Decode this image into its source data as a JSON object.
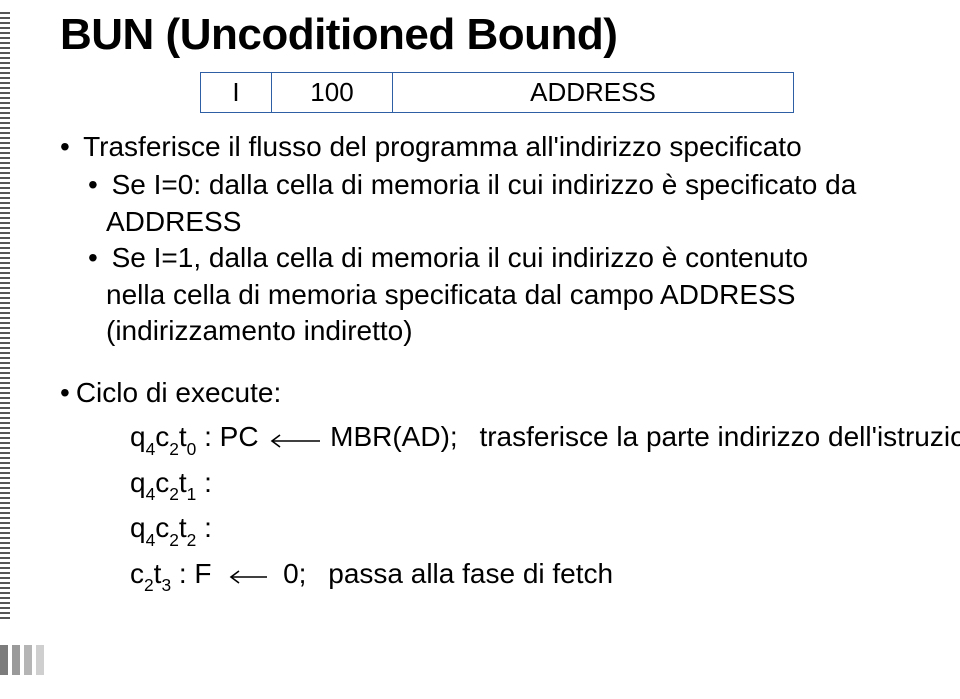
{
  "title": "BUN (Uncoditioned Bound)",
  "instruction": {
    "i": "I",
    "opcode": "100",
    "address": "ADDRESS"
  },
  "bullet_main": "Trasferisce il flusso del programma all'indirizzo specificato",
  "bullet_sub1_a": "Se I=0: dalla cella di memoria il cui indirizzo è specificato da",
  "bullet_sub1_b": "ADDRESS",
  "bullet_sub2_a": "Se I=1, dalla cella di memoria il cui indirizzo è contenuto",
  "bullet_sub2_b": "nella cella di memoria specificata dal campo ADDRESS",
  "bullet_sub2_c": "(indirizzamento indiretto)",
  "cycle_title": "Ciclo di execute:",
  "cycle": {
    "l1_prefix": "q",
    "l1_s1": "4",
    "l1_c": "c",
    "l1_s2": "2",
    "l1_t": "t",
    "l1_s3": "0",
    "l1_colon": " : PC",
    "l1_rhs": "MBR(AD);",
    "l1_comment": "trasferisce la parte indirizzo dell'istruzione",
    "l2_prefix": "q",
    "l2_s1": "4",
    "l2_c": "c",
    "l2_s2": "2",
    "l2_t": "t",
    "l2_s3": "1",
    "l2_colon": " :",
    "l3_prefix": "q",
    "l3_s1": "4",
    "l3_c": "c",
    "l3_s2": "2",
    "l3_t": "t",
    "l3_s3": "2",
    "l3_colon": " :",
    "l4_prefix": "c",
    "l4_s1": "2",
    "l4_t": "t",
    "l4_s2": "3",
    "l4_colon": " : F",
    "l4_rhs": "0;",
    "l4_comment": "passa alla fase di fetch"
  }
}
